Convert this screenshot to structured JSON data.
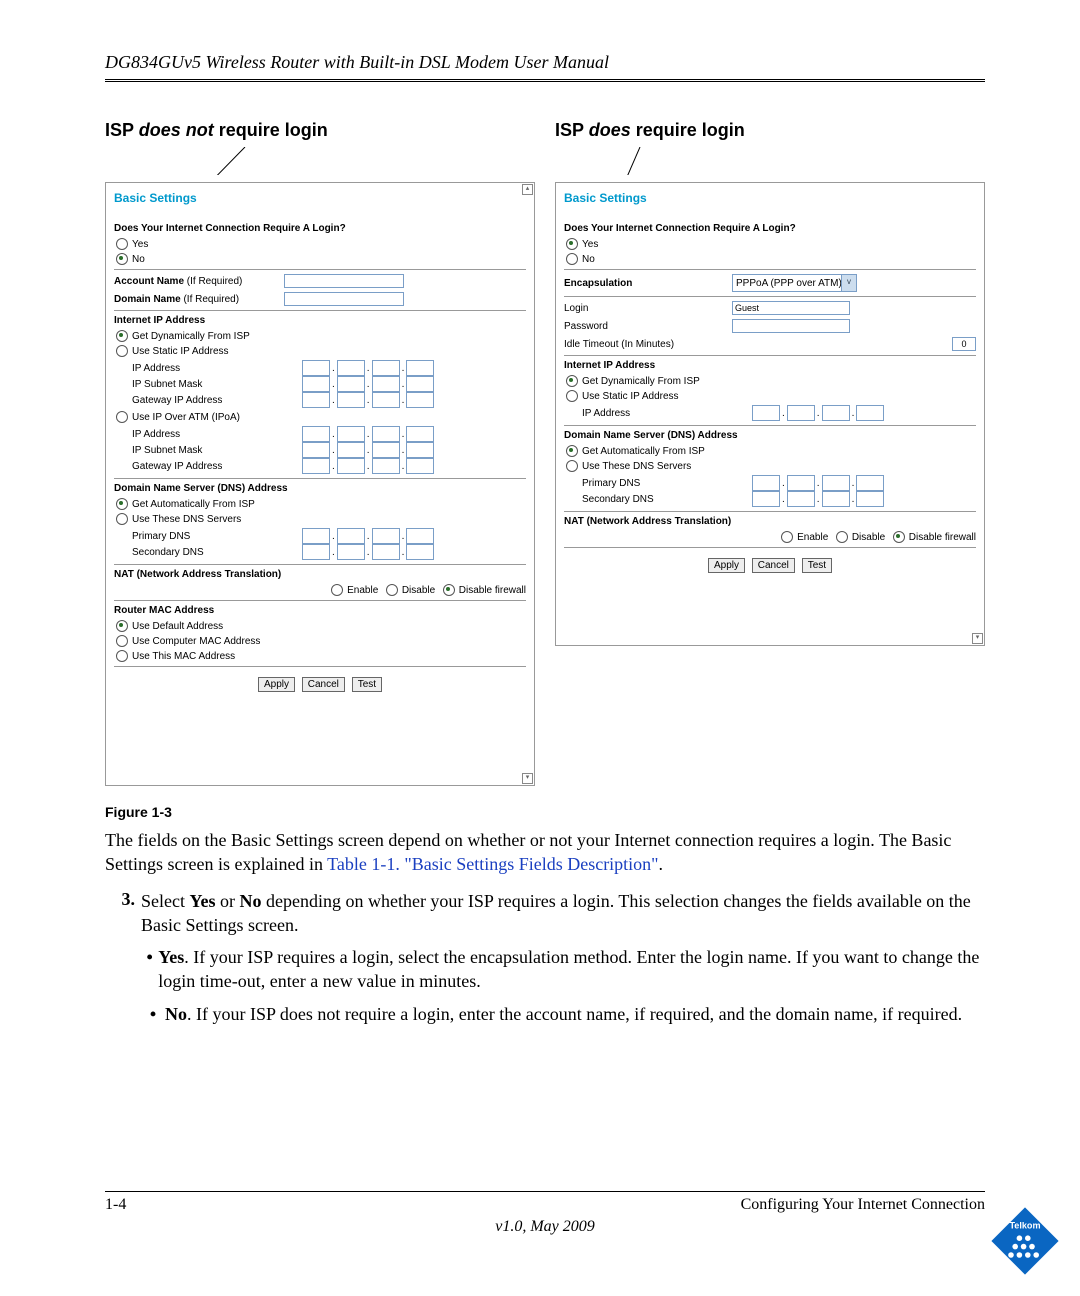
{
  "header": {
    "title": "DG834GUv5 Wireless Router with Built-in DSL Modem User Manual"
  },
  "cols": {
    "left": {
      "heading_pre": "ISP ",
      "heading_em": "does not",
      "heading_post": " require login"
    },
    "right": {
      "heading_pre": "ISP ",
      "heading_em": "does",
      "heading_post": " require login"
    }
  },
  "panel_left": {
    "title": "Basic Settings",
    "q": "Does Your Internet Connection Require A Login?",
    "yes": "Yes",
    "no": "No",
    "acct": "Account Name",
    "acct_note": "(If Required)",
    "dom": "Domain Name",
    "dom_note": "(If Required)",
    "iip": "Internet IP Address",
    "dyn": "Get Dynamically From ISP",
    "static": "Use Static IP Address",
    "ip": "IP Address",
    "mask": "IP Subnet Mask",
    "gw": "Gateway IP Address",
    "ipoa": "Use IP Over ATM (IPoA)",
    "dns_h": "Domain Name Server (DNS) Address",
    "dns_auto": "Get Automatically From ISP",
    "dns_use": "Use These DNS Servers",
    "pdns": "Primary DNS",
    "sdns": "Secondary DNS",
    "nat_h": "NAT (Network Address Translation)",
    "enable": "Enable",
    "disable": "Disable",
    "disfw": "Disable firewall",
    "mac_h": "Router MAC Address",
    "mac1": "Use Default Address",
    "mac2": "Use Computer MAC Address",
    "mac3": "Use This MAC Address",
    "apply": "Apply",
    "cancel": "Cancel",
    "test": "Test"
  },
  "panel_right": {
    "title": "Basic Settings",
    "q": "Does Your Internet Connection Require A Login?",
    "yes": "Yes",
    "no": "No",
    "enc": "Encapsulation",
    "enc_v": "PPPoA (PPP over ATM)",
    "login": "Login",
    "login_v": "Guest",
    "pw": "Password",
    "idle": "Idle Timeout (In Minutes)",
    "idle_v": "0",
    "iip": "Internet IP Address",
    "dyn": "Get Dynamically From ISP",
    "static": "Use Static IP Address",
    "ip": "IP Address",
    "dns_h": "Domain Name Server (DNS) Address",
    "dns_auto": "Get Automatically From ISP",
    "dns_use": "Use These DNS Servers",
    "pdns": "Primary DNS",
    "sdns": "Secondary DNS",
    "nat_h": "NAT (Network Address Translation)",
    "enable": "Enable",
    "disable": "Disable",
    "disfw": "Disable firewall",
    "apply": "Apply",
    "cancel": "Cancel",
    "test": "Test"
  },
  "figure": {
    "caption": "Figure 1-3"
  },
  "para1a": "The fields on the Basic Settings screen depend on whether or not your Internet connection requires a login. The Basic Settings screen is explained in ",
  "para1link": "Table 1-1. \"Basic Settings Fields Description\"",
  "para1b": ".",
  "step3num": "3.",
  "step3a": "Select ",
  "step3yes": "Yes",
  "step3or": " or ",
  "step3no": "No",
  "step3b": " depending on whether your ISP requires a login. This selection changes the fields available on the Basic Settings screen.",
  "bullet_dot": "•",
  "byes_b": "Yes",
  "byes_t": ". If your ISP requires a login, select the encapsulation method. Enter the login name. If you want to change the login time-out, enter a new value in minutes.",
  "bno_b": "No",
  "bno_t": ". If your ISP does not require a login, enter the account name, if required, and the domain name, if required.",
  "footer": {
    "page": "1-4",
    "section": "Configuring Your Internet Connection",
    "version": "v1.0, May 2009"
  },
  "logo": {
    "text": "Telkom"
  }
}
